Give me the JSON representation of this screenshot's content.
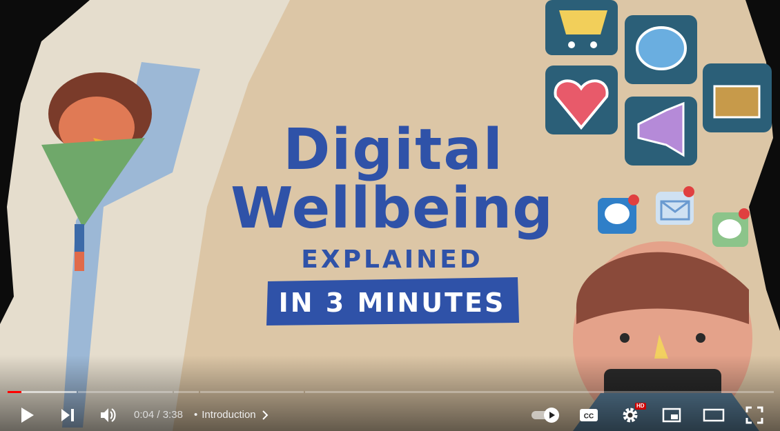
{
  "video": {
    "title_line1": "Digital",
    "title_line2": "Wellbeing",
    "subtitle": "EXPLAINED",
    "tagline": "IN 3 MINUTES"
  },
  "player": {
    "current_time": "0:04",
    "separator": " / ",
    "duration": "3:38",
    "chapter_bullet": "•",
    "chapter": "Introduction",
    "hd_badge": "HD",
    "progress_fraction": 0.018,
    "accent_color": "#ff0000"
  },
  "icons": {
    "play": "play-icon",
    "next": "next-icon",
    "volume": "volume-icon",
    "autoplay": "autoplay-toggle-icon",
    "captions": "captions-icon",
    "settings": "gear-icon",
    "miniplayer": "miniplayer-icon",
    "theater": "theater-mode-icon",
    "fullscreen": "fullscreen-icon"
  }
}
